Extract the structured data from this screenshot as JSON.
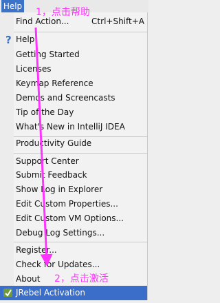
{
  "menubar": {
    "title": "Help"
  },
  "annotations": {
    "step1": "1，点击帮助",
    "step2": "2，点击激活"
  },
  "items": {
    "find_action": {
      "label": "Find Action...",
      "shortcut": "Ctrl+Shift+A"
    },
    "help": {
      "label": "Help"
    },
    "getting_started": {
      "label": "Getting Started"
    },
    "licenses": {
      "label": "Licenses"
    },
    "keymap_reference": {
      "label": "Keymap Reference"
    },
    "demos": {
      "label": "Demos and Screencasts"
    },
    "tip_of_day": {
      "label": "Tip of the Day"
    },
    "whats_new": {
      "label": "What's New in IntelliJ IDEA"
    },
    "productivity": {
      "label": "Productivity Guide"
    },
    "support": {
      "label": "Support Center"
    },
    "feedback": {
      "label": "Submit Feedback"
    },
    "show_log": {
      "label": "Show Log in Explorer"
    },
    "edit_props": {
      "label": "Edit Custom Properties..."
    },
    "edit_vm": {
      "label": "Edit Custom VM Options..."
    },
    "debug_log": {
      "label": "Debug Log Settings..."
    },
    "register": {
      "label": "Register..."
    },
    "check_updates": {
      "label": "Check for Updates..."
    },
    "about": {
      "label": "About"
    },
    "jrebel": {
      "label": "JRebel Activation"
    }
  },
  "colors": {
    "accent": "#3a6ec8",
    "annotation": "#ff35ff"
  }
}
